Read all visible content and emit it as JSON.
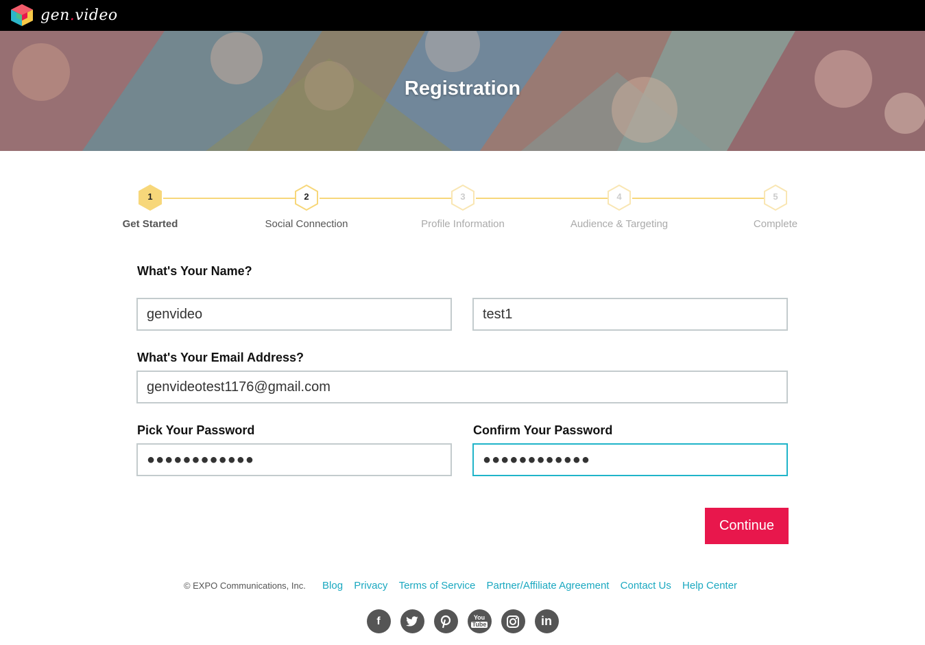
{
  "app": {
    "logo_text": "gen",
    "logo_dot": ".",
    "logo_text2": "video"
  },
  "hero": {
    "title": "Registration"
  },
  "steps": [
    {
      "num": "1",
      "label": "Get Started",
      "state": "active"
    },
    {
      "num": "2",
      "label": "Social Connection",
      "state": "next"
    },
    {
      "num": "3",
      "label": "Profile Information",
      "state": "pending"
    },
    {
      "num": "4",
      "label": "Audience & Targeting",
      "state": "pending"
    },
    {
      "num": "5",
      "label": "Complete",
      "state": "pending"
    }
  ],
  "form": {
    "name_label": "What's Your Name?",
    "first_name_value": "genvideo",
    "last_name_value": "test1",
    "email_label": "What's Your Email Address?",
    "email_value": "genvideotest1176@gmail.com",
    "password_label": "Pick Your Password",
    "password_value": "●●●●●●●●●●●●",
    "confirm_label": "Confirm Your Password",
    "confirm_value": "●●●●●●●●●●●●",
    "continue_label": "Continue"
  },
  "footer": {
    "copyright": "© EXPO Communications, Inc.",
    "links": [
      "Blog",
      "Privacy",
      "Terms of Service",
      "Partner/Affiliate Agreement",
      "Contact Us",
      "Help Center"
    ],
    "socials": [
      {
        "icon": "facebook-icon",
        "glyph": "f"
      },
      {
        "icon": "twitter-icon",
        "glyph": "t"
      },
      {
        "icon": "pinterest-icon",
        "glyph": "p"
      },
      {
        "icon": "youtube-icon",
        "glyph": "You"
      },
      {
        "icon": "instagram-icon",
        "glyph": "◎"
      },
      {
        "icon": "linkedin-icon",
        "glyph": "in"
      }
    ]
  },
  "colors": {
    "accent": "#e8174c",
    "link": "#1aa8c0",
    "step_active": "#f7d77a",
    "focus": "#1fb4c9"
  }
}
